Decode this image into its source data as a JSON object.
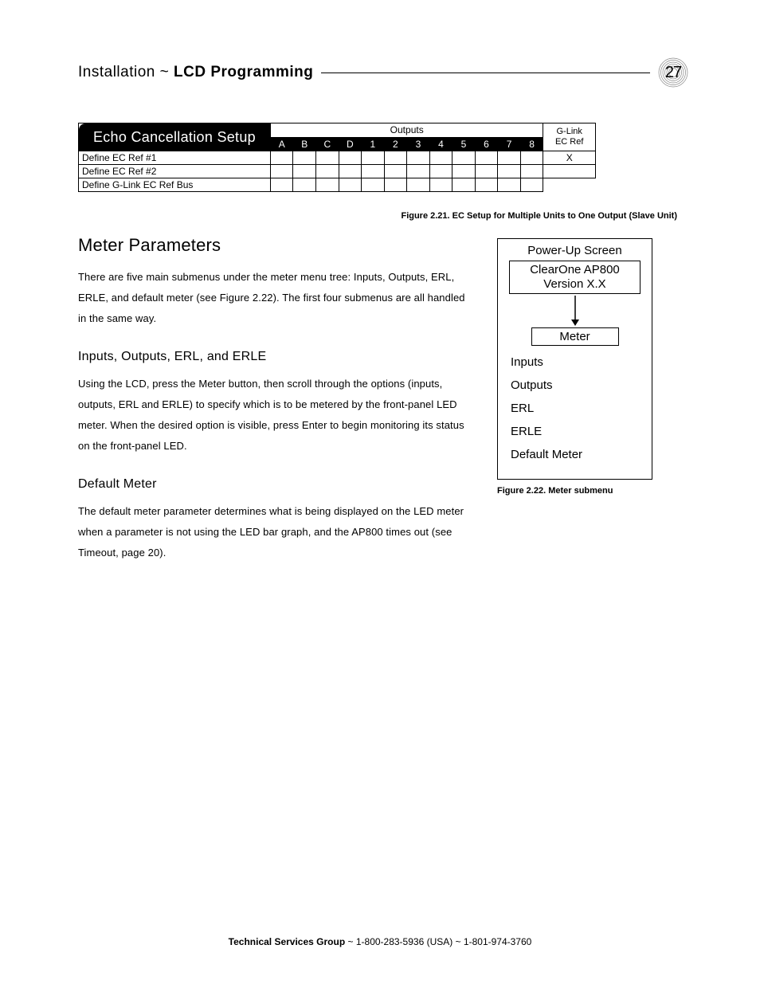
{
  "header": {
    "title_light": "Installation ~ ",
    "title_bold": "LCD Programming",
    "page_number": "27"
  },
  "ec_table": {
    "title": "Echo Cancellation Setup",
    "outputs_label": "Outputs",
    "glink_label_line1": "G-Link",
    "glink_label_line2": "EC Ref",
    "columns": [
      "A",
      "B",
      "C",
      "D",
      "1",
      "2",
      "3",
      "4",
      "5",
      "6",
      "7",
      "8"
    ],
    "rows": [
      {
        "label": "Define EC Ref #1",
        "glink": "X"
      },
      {
        "label": "Define EC Ref #2",
        "glink": ""
      },
      {
        "label": "Define G-Link EC Ref Bus",
        "glink": null
      }
    ],
    "caption": "Figure 2.21.  EC Setup for Multiple Units to One Output (Slave Unit)"
  },
  "sections": {
    "meter_parameters": {
      "heading": "Meter Parameters",
      "para": "There are five main submenus under the meter menu tree: Inputs, Outputs, ERL, ERLE, and default meter (see Figure 2.22). The first four submenus are all handled in the same way."
    },
    "inputs_outputs": {
      "heading": "Inputs, Outputs, ERL, and ERLE",
      "para": "Using the LCD, press the Meter button, then scroll through the options (inputs, outputs, ERL and ERLE) to specify which is to be metered by the front-panel LED meter. When the desired option is visible, press Enter to begin monitoring its status on the front-panel LED."
    },
    "default_meter": {
      "heading": "Default Meter",
      "para": "The default meter parameter determines what is being displayed on the LED meter when a parameter is not using the LED bar graph, and the AP800 times out (see Timeout, page 20)."
    }
  },
  "meter_figure": {
    "top_label": "Power-Up Screen",
    "box_line1": "ClearOne AP800",
    "box_line2": "Version X.X",
    "meter_label": "Meter",
    "items": [
      "Inputs",
      "Outputs",
      "ERL",
      "ERLE",
      "Default Meter"
    ],
    "caption": "Figure 2.22.  Meter submenu"
  },
  "footer": {
    "bold": "Technical Services Group",
    "rest": " ~ 1-800-283-5936 (USA) ~ 1-801-974-3760"
  }
}
